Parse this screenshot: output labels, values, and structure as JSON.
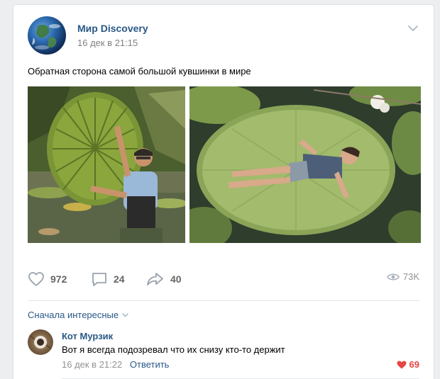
{
  "post": {
    "author": "Мир Discovery",
    "date": "16 дек в 21:15",
    "text": "Обратная сторона самой большой кувшинки в мире",
    "images": [
      {
        "description_icon": "photo-man-with-giant-lily-pad"
      },
      {
        "description_icon": "photo-girl-lying-on-lily-pad"
      }
    ]
  },
  "actions": {
    "likes": "972",
    "comments": "24",
    "shares": "40",
    "views": "73K"
  },
  "comments_section": {
    "sort_label": "Сначала интересные"
  },
  "comment": {
    "author": "Кот Мурзик",
    "text": "Вот я всегда подозревал что их снизу кто-то держит",
    "date": "16 дек в 21:22",
    "reply_label": "Ответить",
    "likes": "69"
  },
  "colors": {
    "link": "#2a5885",
    "meta": "#828282",
    "like_active": "#e64646",
    "background": "#edeef0"
  }
}
